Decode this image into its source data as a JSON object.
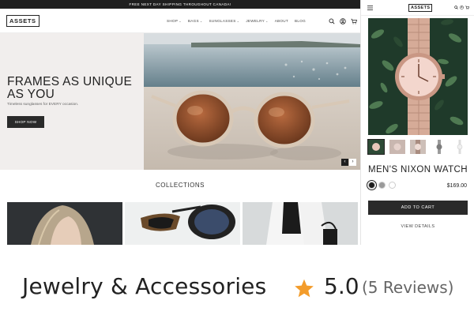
{
  "announcement": "FREE NEXT DAY SHIPPING THROUGHOUT CANADA!",
  "brand": "ASSETS",
  "nav": [
    {
      "label": "SHOP",
      "dropdown": true
    },
    {
      "label": "BAGS",
      "dropdown": true
    },
    {
      "label": "SUNGLASSES",
      "dropdown": true
    },
    {
      "label": "JEWELRY",
      "dropdown": true
    },
    {
      "label": "ABOUT",
      "dropdown": false
    },
    {
      "label": "BLOG",
      "dropdown": false
    }
  ],
  "header_icons": [
    "search-icon",
    "account-icon",
    "cart-icon"
  ],
  "hero": {
    "title": "FRAMES AS UNIQUE AS YOU",
    "subtitle": "Timeless sunglasses for EVERY occasion.",
    "button": "SHOP NOW",
    "prev_icon": "‹",
    "next_icon": "›"
  },
  "collections": {
    "title": "COLLECTIONS"
  },
  "quick_view": {
    "brand": "ASSETS",
    "product_title": "MEN'S NIXON WATCH",
    "price": "$169.00",
    "swatches": [
      {
        "color": "#1e1e1e",
        "selected": true
      },
      {
        "color": "#9a9a9a",
        "selected": false
      },
      {
        "color": "#ffffff",
        "selected": false
      }
    ],
    "add_to_cart": "ADD TO CART",
    "view_details": "VIEW DETAILS",
    "thumbnail_count": 5
  },
  "caption": {
    "category": "Jewelry & Accessories",
    "rating": "5.0",
    "reviews": "(5 Reviews)",
    "star_color": "#f39c2b"
  },
  "colors": {
    "dark": "#2a2a2a",
    "hero_bg": "#f1eeed",
    "accent_star": "#f39c2b"
  }
}
